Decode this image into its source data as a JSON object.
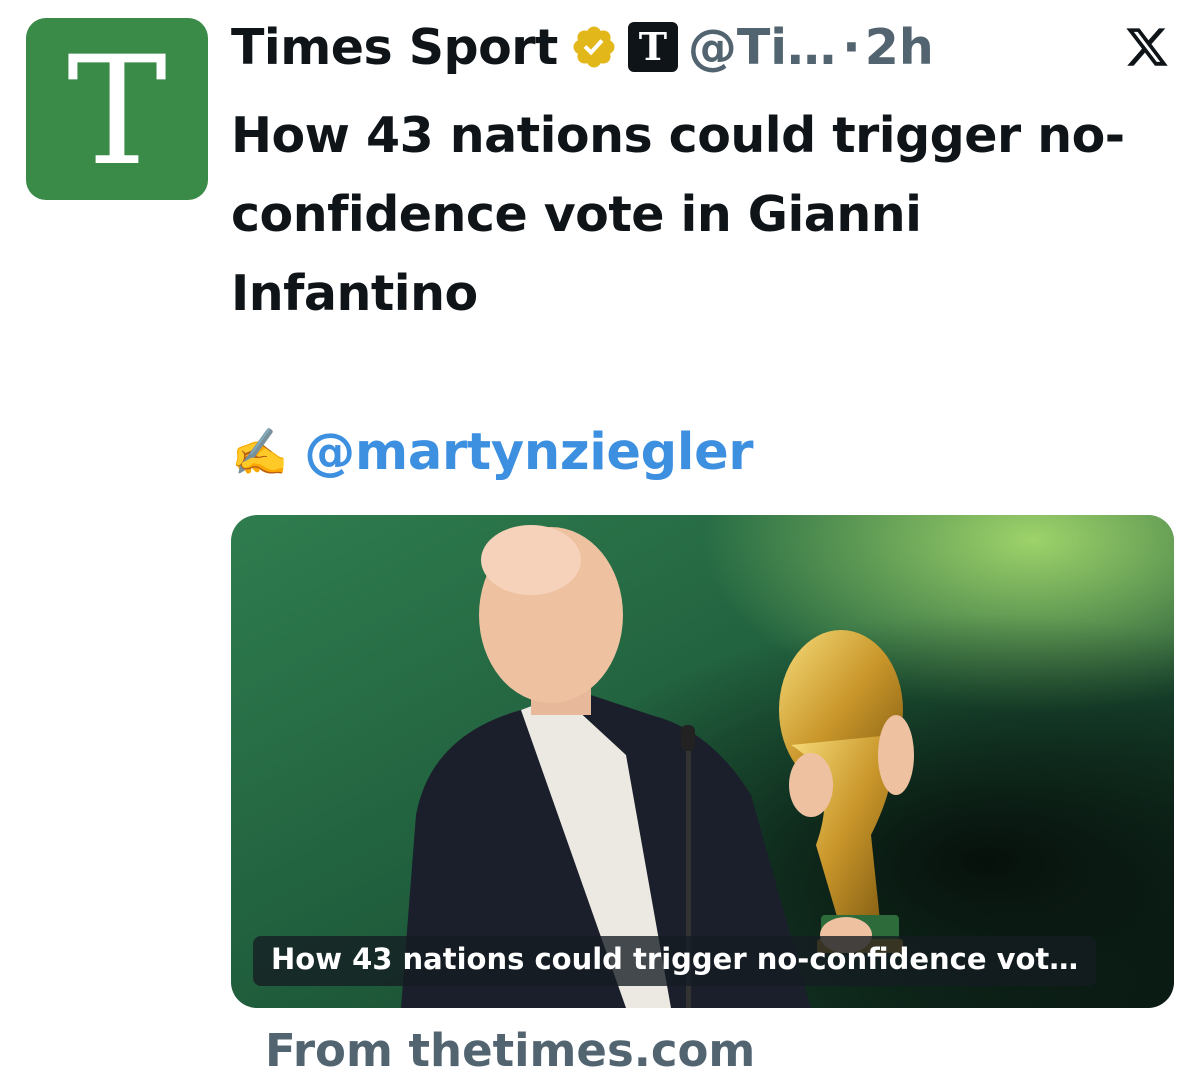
{
  "tweet": {
    "author_name": "Times Sport",
    "avatar_letter": "T",
    "affiliate_letter": "T",
    "handle": "@Ti…",
    "separator": "·",
    "timestamp": "2h",
    "headline": "How 43 nations could trigger no-confidence vote in Gianni Infantino",
    "credit_emoji": "✍️",
    "mention": "@martynziegler",
    "card": {
      "caption": "How 43 nations could trigger no-confidence vot…",
      "source": "From thetimes.com"
    }
  },
  "icons": {
    "verified": "verified-badge-icon",
    "affiliate": "times-affiliate-badge-icon",
    "platform": "x-logo-icon",
    "credit": "writing-hand-icon"
  },
  "colors": {
    "avatar_bg": "#3a8a48",
    "verified_gold": "#e2b719",
    "mention_blue": "#3d8fe0",
    "secondary_text": "#536471",
    "primary_text": "#0f1419"
  }
}
